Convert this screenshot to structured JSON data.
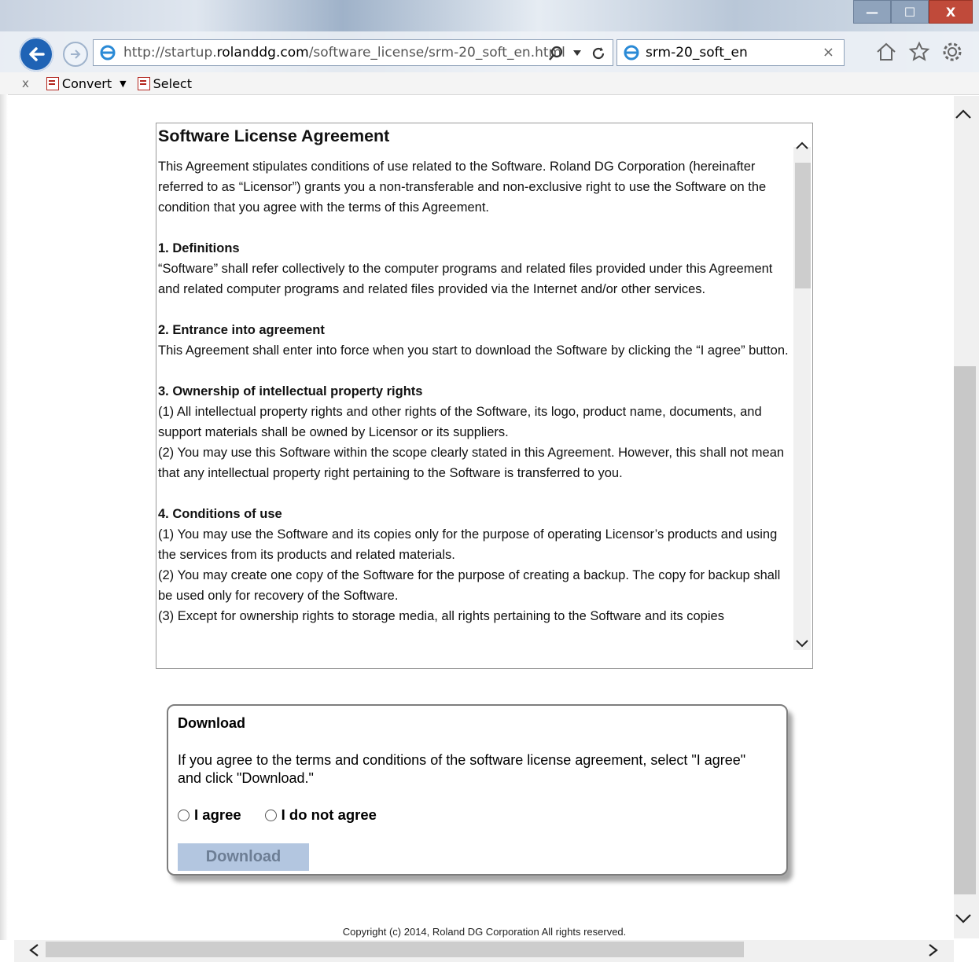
{
  "browser": {
    "url_prefix": "http://startup.",
    "url_domain": "rolanddg.com",
    "url_path": "/software_license/srm-20_soft_en.html",
    "tab_title": "srm-20_soft_en",
    "tab_close": "×",
    "command_close": "x",
    "convert_label": "Convert",
    "select_label": "Select",
    "window_buttons": {
      "minimize": "—",
      "maximize": "☐",
      "close": "X"
    }
  },
  "license": {
    "title": "Software License Agreement",
    "intro": "This Agreement stipulates conditions of use related to the Software. Roland DG Corporation (hereinafter referred to as “Licensor”) grants you a non-transferable and non-exclusive right to use the Software on the condition that you agree with the terms of this Agreement.",
    "sec1_title": "1. Definitions",
    "sec1_text": "“Software” shall refer collectively to the computer programs and related files provided under this Agreement and related computer programs and related files provided via the Internet and/or other services.",
    "sec2_title": "2. Entrance into agreement",
    "sec2_text": "This Agreement shall enter into force when you start to download the Software by clicking the “I agree” button.",
    "sec3_title": "3. Ownership of intellectual property rights",
    "sec3_p1": "(1) All intellectual property rights and other rights of the Software, its logo, product name, documents, and support materials shall be owned by Licensor or its suppliers.",
    "sec3_p2": "(2) You may use this Software within the scope clearly stated in this Agreement. However, this shall not mean that any intellectual property right pertaining to the Software is transferred to you.",
    "sec4_title": "4. Conditions of use",
    "sec4_p1": "(1) You may use the Software and its copies only for the purpose of operating Licensor’s products and using the services from its products and related materials.",
    "sec4_p2": "(2) You may create one copy of the Software for the purpose of creating a backup. The copy for backup shall be used only for recovery of the Software.",
    "sec4_p3": "(3) Except for ownership rights to storage media, all rights pertaining to the Software and its copies"
  },
  "download": {
    "title": "Download",
    "instructions": "If you agree to the terms and conditions of the software license agreement, select \"I agree\" and click \"Download.\"",
    "agree_label": "I agree",
    "disagree_label": "I do not agree",
    "button_label": "Download"
  },
  "footer": {
    "copyright": "Copyright (c) 2014, Roland DG Corporation All rights reserved."
  }
}
